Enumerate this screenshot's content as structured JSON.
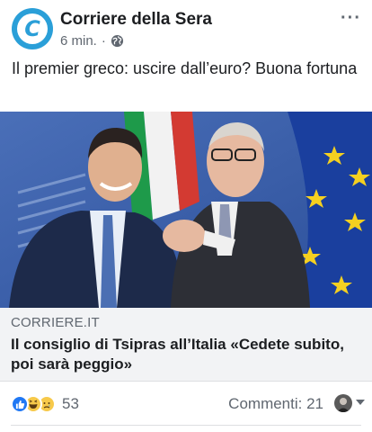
{
  "post": {
    "page_name": "Corriere della Sera",
    "avatar_letter": "C",
    "time": "6 min.",
    "separator": "·",
    "privacy_icon": "globe-icon",
    "more": "···",
    "text": "Il premier greco: uscire dall’euro? Buona fortuna"
  },
  "link": {
    "domain": "CORRIERE.IT",
    "title": "Il consiglio di Tsipras all’Italia «Cedete subito, poi sarà peggio»"
  },
  "footer": {
    "reaction_icons": [
      "like-icon",
      "haha-icon",
      "sad-icon"
    ],
    "reaction_count": "53",
    "comments": "Commenti: 21"
  },
  "colors": {
    "brand": "#2a9fd8",
    "like": "#2078f4",
    "secondary_text": "#606770",
    "link_box_bg": "#f2f3f5"
  }
}
